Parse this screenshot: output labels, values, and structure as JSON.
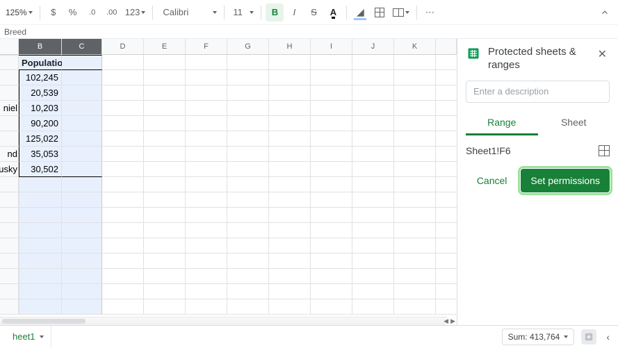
{
  "toolbar": {
    "zoom": "125%",
    "currency": "$",
    "percent": "%",
    "dec_dec": ".0",
    "dec_inc": ".00",
    "more_formats": "123",
    "font": "Calibri",
    "font_size": "11",
    "bold": "B",
    "italic": "I",
    "strike": "S",
    "textcolor": "A",
    "more": "⋯"
  },
  "namebox": "Breed",
  "columns": [
    "B",
    "C",
    "D",
    "E",
    "F",
    "G",
    "H",
    "I",
    "J",
    "K"
  ],
  "selected_cols": [
    "B",
    "C"
  ],
  "grid": {
    "header_a_overflow": "",
    "header_b": "Population",
    "rows": [
      {
        "a": "",
        "b": "102,245"
      },
      {
        "a": "",
        "b": "20,539"
      },
      {
        "a": "niel",
        "b": "10,203"
      },
      {
        "a": "",
        "b": "90,200"
      },
      {
        "a": "",
        "b": "125,022"
      },
      {
        "a": "nd",
        "b": "35,053"
      },
      {
        "a": "usky",
        "b": "30,502"
      }
    ]
  },
  "sidebar": {
    "title": "Protected sheets & ranges",
    "desc_placeholder": "Enter a description",
    "tab_range": "Range",
    "tab_sheet": "Sheet",
    "range_value": "Sheet1!F6",
    "cancel": "Cancel",
    "set_perms": "Set permissions"
  },
  "sheetbar": {
    "tab1": "heet1",
    "sum": "Sum: 413,764"
  }
}
